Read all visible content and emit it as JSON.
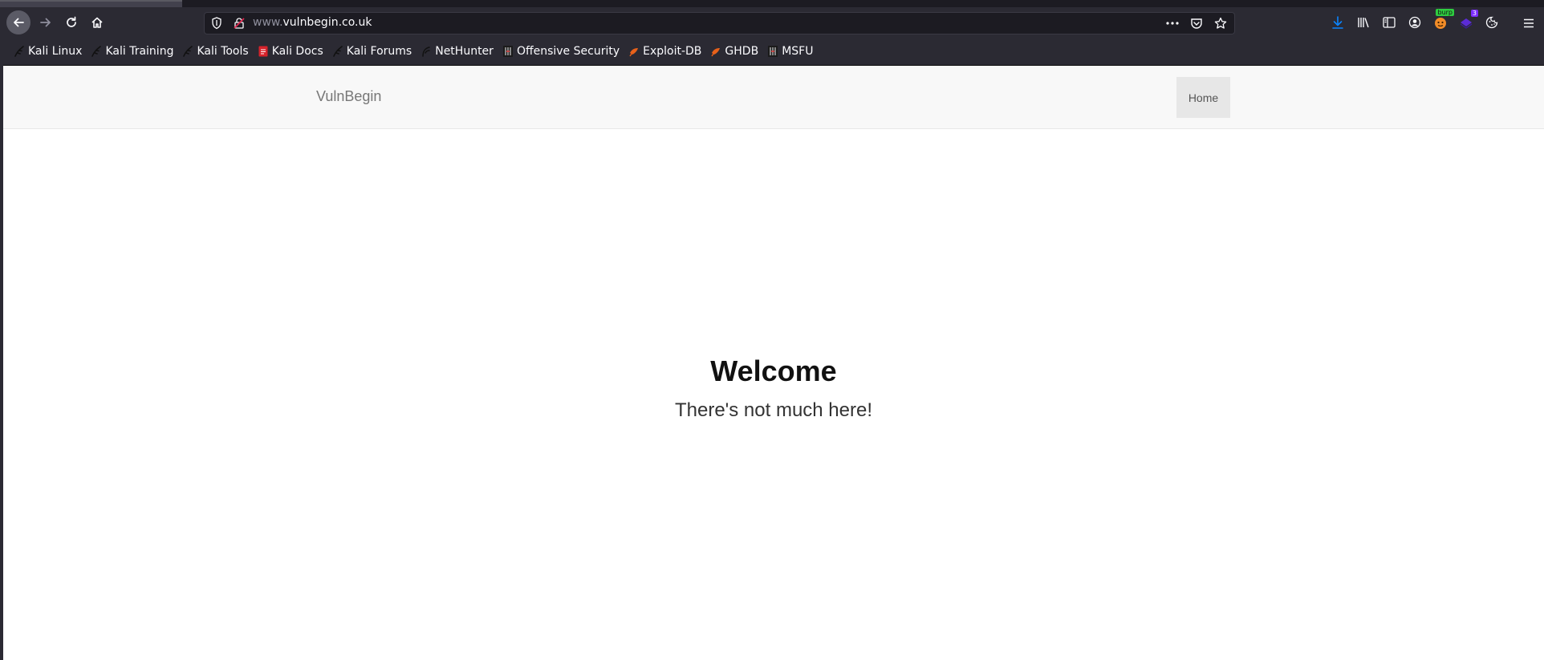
{
  "browser": {
    "url_prefix": "www.",
    "url_domain": "vulnbegin.co.uk",
    "burp_badge": "burp",
    "extension_badge_count": "3",
    "colors": {
      "chrome_bg": "#2b2a33",
      "urlbar_bg": "#1c1b22",
      "download_accent": "#0a84ff"
    }
  },
  "bookmarks": [
    {
      "label": "Kali Linux",
      "icon": "kali-dragon-icon"
    },
    {
      "label": "Kali Training",
      "icon": "kali-dragon-icon"
    },
    {
      "label": "Kali Tools",
      "icon": "kali-dragon-icon"
    },
    {
      "label": "Kali Docs",
      "icon": "kali-docs-icon"
    },
    {
      "label": "Kali Forums",
      "icon": "kali-dragon-icon"
    },
    {
      "label": "NetHunter",
      "icon": "nethunter-icon"
    },
    {
      "label": "Offensive Security",
      "icon": "offsec-icon"
    },
    {
      "label": "Exploit-DB",
      "icon": "exploitdb-icon"
    },
    {
      "label": "GHDB",
      "icon": "exploitdb-icon"
    },
    {
      "label": "MSFU",
      "icon": "offsec-icon"
    }
  ],
  "site": {
    "brand": "VulnBegin",
    "nav": {
      "home_label": "Home"
    },
    "hero": {
      "title": "Welcome",
      "subtitle": "There's not much here!"
    }
  }
}
